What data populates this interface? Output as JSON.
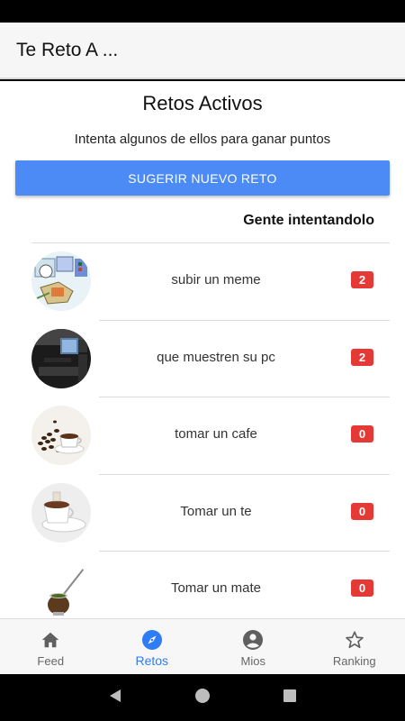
{
  "app_title": "Te Reto A ...",
  "page": {
    "title": "Retos Activos",
    "subtitle": "Intenta algunos de ellos para ganar puntos",
    "suggest_button": "SUGERIR NUEVO RETO",
    "column_header": "Gente intentandolo"
  },
  "challenges": [
    {
      "label": "subir un meme",
      "count": "2"
    },
    {
      "label": "que muestren su pc",
      "count": "2"
    },
    {
      "label": "tomar un cafe",
      "count": "0"
    },
    {
      "label": "Tomar un te",
      "count": "0"
    },
    {
      "label": "Tomar un mate",
      "count": "0"
    }
  ],
  "tabs": [
    {
      "label": "Feed",
      "icon": "home-icon"
    },
    {
      "label": "Retos",
      "icon": "compass-icon",
      "active": true
    },
    {
      "label": "Mios",
      "icon": "account-circle-icon"
    },
    {
      "label": "Ranking",
      "icon": "star-icon"
    }
  ],
  "colors": {
    "accent": "#4c8bf5",
    "active_tab": "#2f7cf6",
    "badge": "#e53935"
  }
}
